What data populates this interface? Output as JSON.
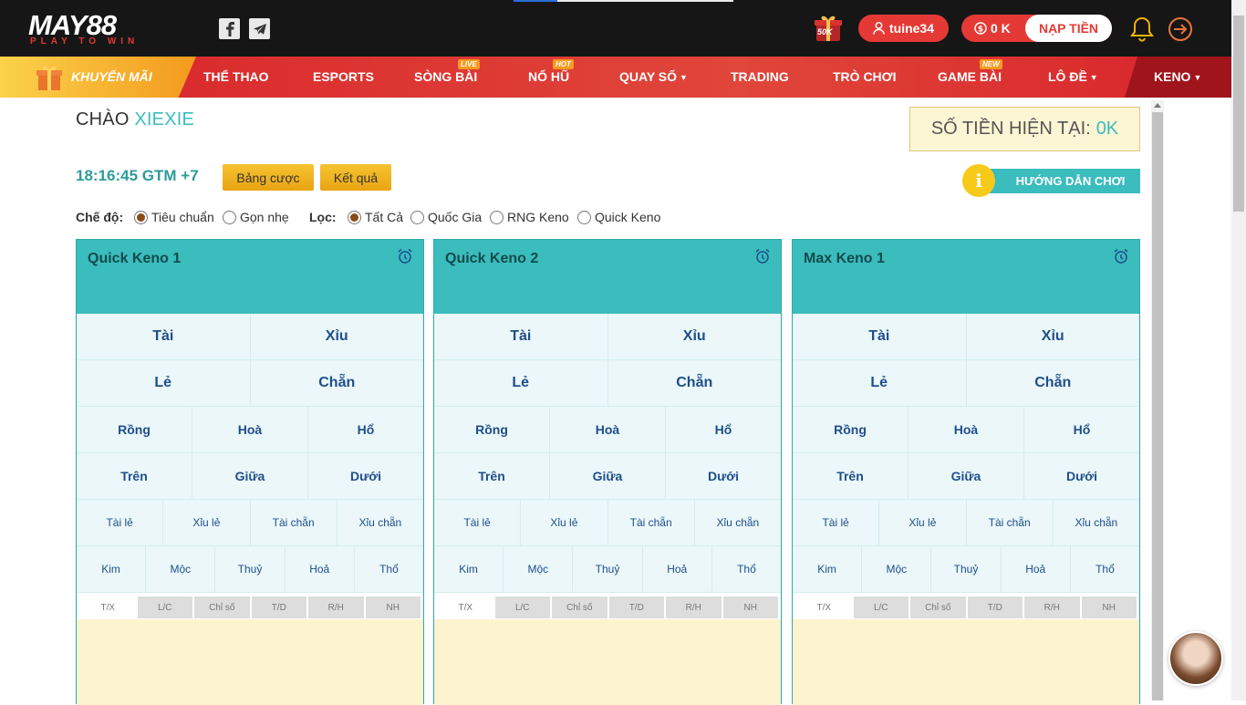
{
  "header": {
    "logo_text": "MAY88",
    "logo_tagline": "PLAY TO WIN",
    "promo_badge": "50K",
    "username": "tuine34",
    "balance": "0 K",
    "deposit_label": "NẠP TIỀN"
  },
  "nav": {
    "promo": "KHUYẾN MÃI",
    "items": [
      {
        "label": "THỂ THAO"
      },
      {
        "label": "ESPORTS"
      },
      {
        "label": "SÒNG BÀI",
        "badge": "LIVE"
      },
      {
        "label": "NỔ HŨ",
        "badge": "HOT"
      },
      {
        "label": "QUAY SỐ"
      },
      {
        "label": "TRADING"
      },
      {
        "label": "TRÒ CHƠI"
      },
      {
        "label": "GAME BÀI",
        "badge": "NEW"
      },
      {
        "label": "LÔ ĐỀ"
      },
      {
        "label": "KENO"
      }
    ]
  },
  "main": {
    "greet_prefix": "CHÀO",
    "greet_name": "XIEXIE",
    "balance_label": "SỐ TIỀN HIỆN TẠI:",
    "balance_value": "0K",
    "clock": "18:16:45 GTM +7",
    "bet_table_btn": "Bảng cược",
    "results_btn": "Kết quả",
    "guide_btn": "HƯỚNG DẪN CHƠI",
    "guide_icon_glyph": "i",
    "mode_label": "Chế độ:",
    "mode_options": [
      "Tiêu chuẩn",
      "Gọn nhẹ"
    ],
    "filter_label": "Lọc:",
    "filter_options": [
      "Tất Cả",
      "Quốc Gia",
      "RNG Keno",
      "Quick Keno"
    ]
  },
  "card_titles": [
    "Quick Keno 1",
    "Quick Keno 2",
    "Max Keno 1"
  ],
  "bet": {
    "tai": "Tài",
    "xiu": "Xỉu",
    "le": "Lẻ",
    "chan": "Chẵn",
    "rong": "Rồng",
    "hoa_draw": "Hoà",
    "ho": "Hổ",
    "tren": "Trên",
    "giua": "Giữa",
    "duoi": "Dưới",
    "tai_le": "Tài lẻ",
    "xiu_le": "Xỉu lẻ",
    "tai_chan": "Tài chẵn",
    "xiu_chan": "Xỉu chẵn",
    "kim": "Kim",
    "moc": "Mộc",
    "thuy": "Thuỷ",
    "hoa_fire": "Hoả",
    "tho": "Thổ"
  },
  "subtabs": [
    "T/X",
    "L/C",
    "Chỉ số",
    "T/D",
    "R/H",
    "NH"
  ],
  "colors": {
    "teal": "#3bbcbd",
    "red": "#e53935",
    "yellow": "#f6c331",
    "cell_bg": "#ebf7f8",
    "panel_bg": "#fdf3ce"
  }
}
